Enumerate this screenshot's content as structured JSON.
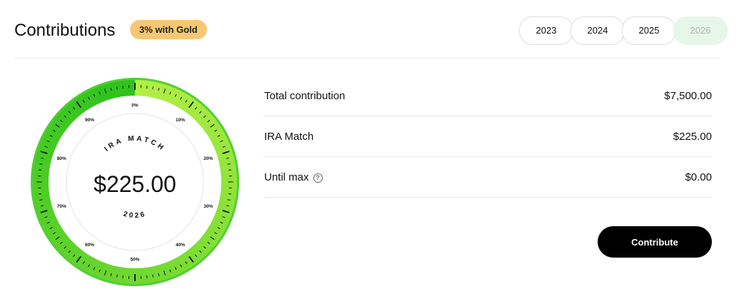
{
  "header": {
    "title": "Contributions",
    "badge": "3% with Gold",
    "years": [
      {
        "label": "2023",
        "active": false
      },
      {
        "label": "2024",
        "active": false
      },
      {
        "label": "2025",
        "active": false
      },
      {
        "label": "2026",
        "active": true
      }
    ]
  },
  "dial": {
    "top_text": "IRA MATCH",
    "amount": "$225.00",
    "bottom_text": "2026",
    "percent_labels": [
      "0%",
      "10%",
      "20%",
      "30%",
      "40%",
      "50%",
      "60%",
      "70%",
      "80%",
      "90%"
    ],
    "fill_fraction": 0.97,
    "colors": {
      "ring_start": "#b3ef45",
      "ring_end": "#30c21d",
      "ring_outer_edge": "#4fcf33",
      "tick": "#111111"
    }
  },
  "summary": {
    "rows": [
      {
        "label": "Total contribution",
        "value": "$7,500.00"
      },
      {
        "label": "IRA Match",
        "value": "$225.00"
      },
      {
        "label": "Until max",
        "value": "$0.00",
        "help_icon": "question-circle-icon"
      }
    ],
    "contribute_label": "Contribute"
  }
}
